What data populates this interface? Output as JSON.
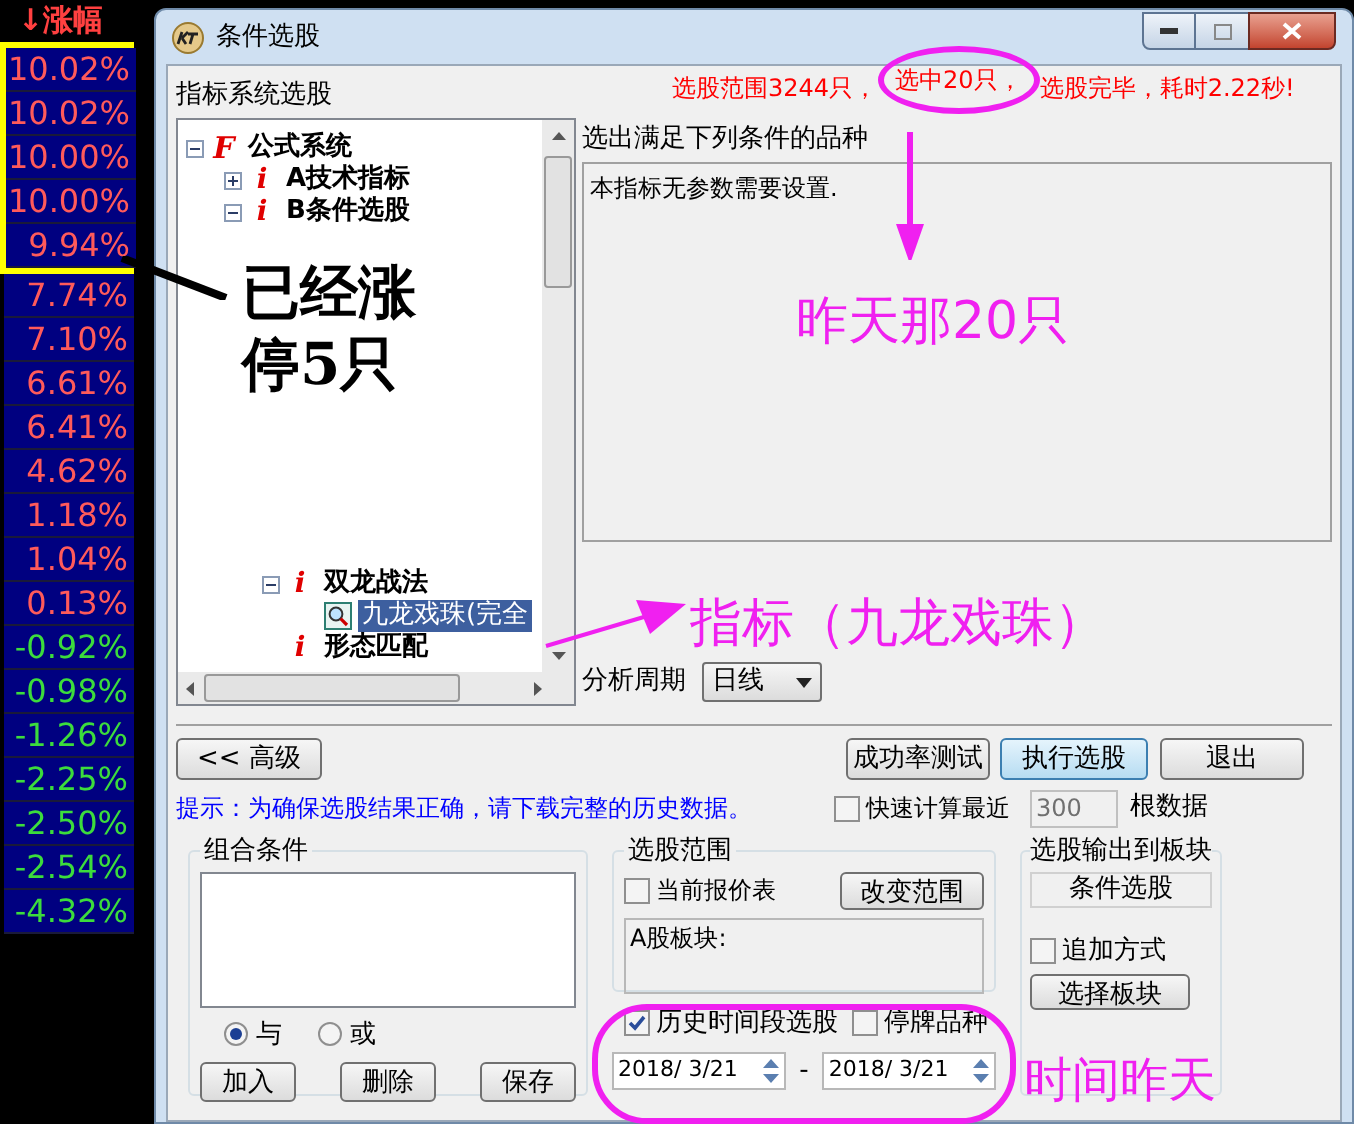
{
  "quote_column": {
    "header": "↓涨幅",
    "rows": [
      {
        "value": "10.02%",
        "falling": false,
        "highlighted": true
      },
      {
        "value": "10.02%",
        "falling": false,
        "highlighted": true
      },
      {
        "value": "10.00%",
        "falling": false,
        "highlighted": true
      },
      {
        "value": "10.00%",
        "falling": false,
        "highlighted": true
      },
      {
        "value": "9.94%",
        "falling": false,
        "highlighted": true
      },
      {
        "value": "7.74%",
        "falling": false,
        "highlighted": false
      },
      {
        "value": "7.10%",
        "falling": false,
        "highlighted": false
      },
      {
        "value": "6.61%",
        "falling": false,
        "highlighted": false
      },
      {
        "value": "6.41%",
        "falling": false,
        "highlighted": false
      },
      {
        "value": "4.62%",
        "falling": false,
        "highlighted": false
      },
      {
        "value": "1.18%",
        "falling": false,
        "highlighted": false
      },
      {
        "value": "1.04%",
        "falling": false,
        "highlighted": false
      },
      {
        "value": "0.13%",
        "falling": false,
        "highlighted": false
      },
      {
        "value": "-0.92%",
        "falling": true,
        "highlighted": false
      },
      {
        "value": "-0.98%",
        "falling": true,
        "highlighted": false
      },
      {
        "value": "-1.26%",
        "falling": true,
        "highlighted": false
      },
      {
        "value": "-2.25%",
        "falling": true,
        "highlighted": false
      },
      {
        "value": "-2.50%",
        "falling": true,
        "highlighted": false
      },
      {
        "value": "-2.54%",
        "falling": true,
        "highlighted": false
      },
      {
        "value": "-4.32%",
        "falling": true,
        "highlighted": false
      }
    ]
  },
  "window": {
    "title": "条件选股"
  },
  "section_label": "指标系统选股",
  "status": {
    "before": "选股范围3244只，",
    "circled": "选中20只，",
    "after": "选股完毕，耗时2.22秒!"
  },
  "tree": [
    {
      "label": "公式系统",
      "kind": "system",
      "badge": "F",
      "expanded": true,
      "selected": false,
      "children": [
        {
          "label": "A技术指标",
          "kind": "group",
          "badge": "i",
          "expanded": false,
          "selected": false
        },
        {
          "label": "B条件选股",
          "kind": "group",
          "badge": "i",
          "expanded": true,
          "selected": false,
          "children": [
            {
              "label": "双龙战法",
              "kind": "group",
              "badge": "i",
              "expanded": true,
              "selected": false,
              "children": [
                {
                  "label": "九龙戏珠(完全",
                  "kind": "formula",
                  "selected": true
                }
              ]
            },
            {
              "label": "形态匹配",
              "kind": "group",
              "badge": "i",
              "selected": false
            }
          ]
        }
      ]
    }
  ],
  "conditions_label": "选出满足下列条件的品种",
  "parameters_text": "本指标无参数需要设置.",
  "period": {
    "label": "分析周期",
    "value": "日线"
  },
  "buttons": {
    "advanced": "<< 高级",
    "test": "成功率测试",
    "run": "执行选股",
    "exit": "退出"
  },
  "hint": "提示：为确保选股结果正确，请下载完整的历史数据。",
  "quick_calc": {
    "label": "快速计算最近",
    "checked": false,
    "value": "300",
    "disabled": true,
    "suffix": "根数据"
  },
  "combine": {
    "title": "组合条件",
    "options": [
      {
        "label": "与",
        "selected": true
      },
      {
        "label": "或",
        "selected": false
      }
    ],
    "buttons": [
      "加入",
      "删除",
      "保存"
    ]
  },
  "range": {
    "title": "选股范围",
    "current_quote": {
      "label": "当前报价表",
      "checked": false
    },
    "change_button": "改变范围",
    "range_text": "A股板块:"
  },
  "history": {
    "label": "历史时间段选股",
    "checked": true,
    "suspended": {
      "label": "停牌品种",
      "checked": false
    },
    "from": "2018/ 3/21",
    "separator": "-",
    "to": "2018/ 3/21"
  },
  "output": {
    "title": "选股输出到板块",
    "block": "条件选股",
    "append": {
      "label": "追加方式",
      "checked": false
    },
    "choose_button": "选择板块"
  },
  "annotations": {
    "limit_up_note": "已经涨停5只",
    "yesterday_note": "昨天那20只",
    "indicator_note": "指标（九龙戏珠）",
    "time_note": "时间昨天"
  }
}
